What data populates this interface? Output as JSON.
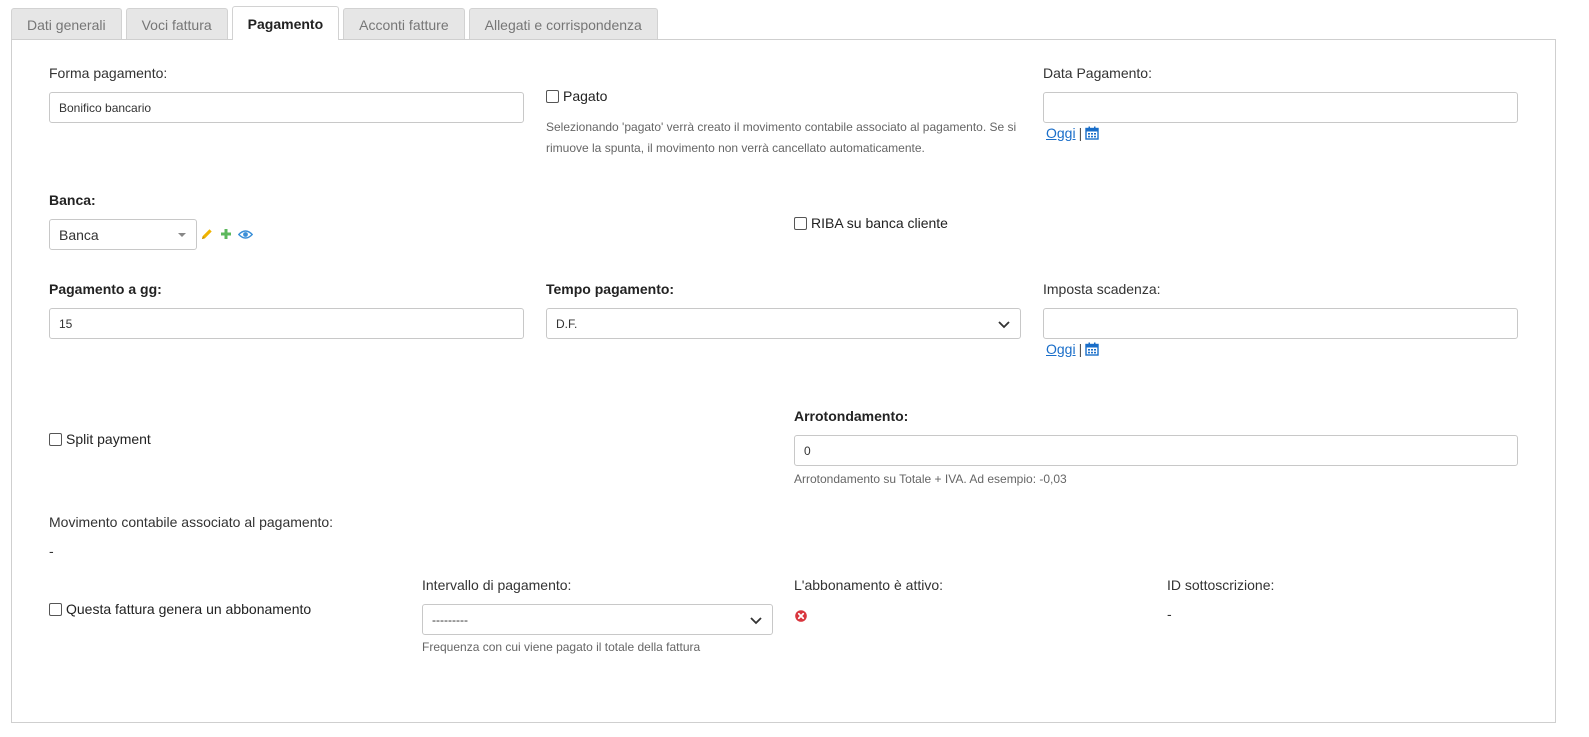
{
  "tabs": [
    "Dati generali",
    "Voci fattura",
    "Pagamento",
    "Acconti fatture",
    "Allegati e corrispondenza"
  ],
  "active_tab": "Pagamento",
  "forma_pagamento": {
    "label": "Forma pagamento:",
    "value": "Bonifico bancario"
  },
  "pagato": {
    "label": "Pagato",
    "help": "Selezionando 'pagato' verrà creato il movimento contabile associato al pagamento. Se si rimuove la spunta, il movimento non verrà cancellato automaticamente."
  },
  "data_pagamento": {
    "label": "Data Pagamento:",
    "value": "",
    "today_link": "Oggi",
    "separator": "|"
  },
  "banca": {
    "label": "Banca:",
    "value": "Banca"
  },
  "riba": {
    "label": "RIBA su banca cliente"
  },
  "pagamento_gg": {
    "label": "Pagamento a gg:",
    "value": "15"
  },
  "tempo_pagamento": {
    "label": "Tempo pagamento:",
    "value": "D.F."
  },
  "imposta_scadenza": {
    "label": "Imposta scadenza:",
    "value": "",
    "today_link": "Oggi",
    "separator": "|"
  },
  "split_payment": {
    "label": "Split payment"
  },
  "arrotondamento": {
    "label": "Arrotondamento:",
    "value": "0",
    "help": "Arrotondamento su Totale + IVA. Ad esempio: -0,03"
  },
  "movimento": {
    "label": "Movimento contabile associato al pagamento:",
    "value": "-"
  },
  "abbonamento": {
    "label": "Questa fattura genera un abbonamento"
  },
  "intervallo": {
    "label": "Intervallo di pagamento:",
    "value": "---------",
    "help": "Frequenza con cui viene pagato il totale della fattura"
  },
  "abbonamento_attivo": {
    "label": "L'abbonamento è attivo:"
  },
  "id_sottoscrizione": {
    "label": "ID sottoscrizione:",
    "value": "-"
  },
  "colors": {
    "link": "#1a6ec9",
    "pencil": "#f0b400",
    "plus": "#5cb85c",
    "eye": "#3a8fd8",
    "inactive": "#d9363e"
  },
  "icons": [
    "pencil-icon",
    "plus-icon",
    "eye-icon",
    "calendar-icon",
    "x-circle-icon",
    "chevron-down-icon",
    "caret-down-icon"
  ]
}
